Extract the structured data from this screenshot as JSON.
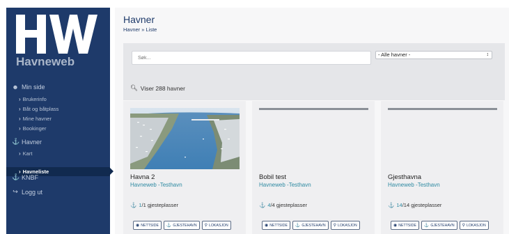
{
  "logo": {
    "monogram": "HW",
    "name": "Havneweb"
  },
  "sidebar": {
    "sections": [
      {
        "label": "Min side",
        "icon": "user-icon"
      },
      {
        "label": "Havner",
        "icon": "harbor-icon"
      },
      {
        "label": "KNBF",
        "icon": "anchor-icon"
      },
      {
        "label": "Logg ut",
        "icon": "logout-icon"
      }
    ],
    "min_side_items": [
      "Brukerinfo",
      "Båt og båtplass",
      "Mine havner",
      "Bookinger"
    ],
    "havner_items": [
      "Kart",
      "Havneliste"
    ]
  },
  "header": {
    "title": "Havner",
    "breadcrumb": "Havner » Liste"
  },
  "filters": {
    "search_placeholder": "Søk...",
    "select_value": "- Alle havner -",
    "count_text": "Viser 288 havner"
  },
  "cards": [
    {
      "title": "Havna 2",
      "subtitle": "Havneweb -Testhavn",
      "available": "1",
      "total": "/1 gjesteplasser"
    },
    {
      "title": "Bobil test",
      "subtitle": "Havneweb -Testhavn",
      "available": "4",
      "total": "/4 gjesteplasser"
    },
    {
      "title": "Gjesthavna",
      "subtitle": "Havneweb -Testhavn",
      "available": "14",
      "total": "/14 gjesteplasser"
    }
  ],
  "buttons": {
    "website": "NETTSIDE",
    "guest_harbor": "GJESTEHAVN",
    "location": "LOKASJON"
  },
  "colors": {
    "sidebar": "#1e3a6a",
    "accent": "#2e8aa2",
    "active": "#112a4f"
  }
}
